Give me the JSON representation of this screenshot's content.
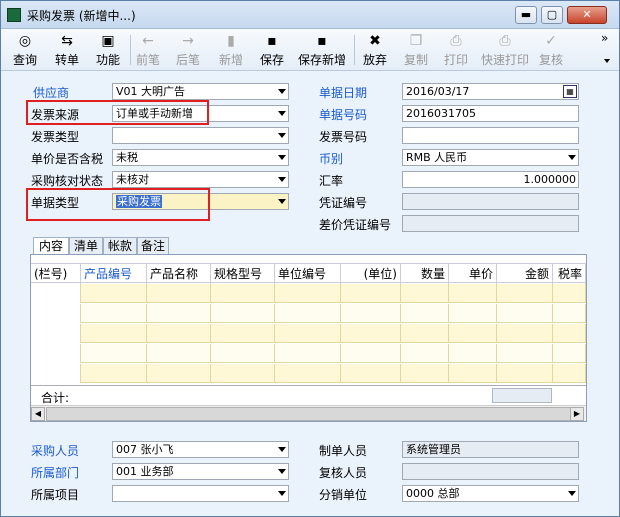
{
  "window": {
    "title": "采购发票 (新增中...)",
    "min_glyph": "▬",
    "max_glyph": "▢",
    "close_glyph": "✕"
  },
  "toolbar": {
    "buttons": [
      {
        "label": "查询",
        "icon": "query-icon",
        "glyph": "◎",
        "enabled": true
      },
      {
        "label": "转单",
        "icon": "convert-icon",
        "glyph": "⇆",
        "enabled": true
      },
      {
        "label": "功能",
        "icon": "function-icon",
        "glyph": "▣",
        "enabled": true
      },
      {
        "label": "前笔",
        "icon": "prev-icon",
        "glyph": "←",
        "enabled": false
      },
      {
        "label": "后笔",
        "icon": "next-icon",
        "glyph": "→",
        "enabled": false
      },
      {
        "label": "新增",
        "icon": "new-icon",
        "glyph": "▮",
        "enabled": false
      },
      {
        "label": "保存",
        "icon": "save-icon",
        "glyph": "▪",
        "enabled": true
      },
      {
        "label": "保存新增",
        "icon": "save-new-icon",
        "glyph": "▪",
        "enabled": true
      },
      {
        "label": "放弃",
        "icon": "abandon-icon",
        "glyph": "✖",
        "enabled": true
      },
      {
        "label": "复制",
        "icon": "copy-icon",
        "glyph": "❐",
        "enabled": false
      },
      {
        "label": "打印",
        "icon": "print-icon",
        "glyph": "⎙",
        "enabled": false
      },
      {
        "label": "快速打印",
        "icon": "quick-print-icon",
        "glyph": "⎙",
        "enabled": false
      },
      {
        "label": "复核",
        "icon": "review-icon",
        "glyph": "✓",
        "enabled": false
      }
    ],
    "overflow_glyph": "»"
  },
  "form": {
    "supplier": {
      "label": "供应商",
      "value": "V01 大明广告"
    },
    "invoice_source": {
      "label": "发票来源",
      "value": "订单或手动新增"
    },
    "invoice_type": {
      "label": "发票类型",
      "value": ""
    },
    "tax_included": {
      "label": "单价是否含税",
      "value": "未税"
    },
    "verify_status": {
      "label": "采购核对状态",
      "value": "未核对"
    },
    "doc_type": {
      "label": "单据类型",
      "value": "采购发票"
    },
    "doc_date": {
      "label": "单据日期",
      "value": "2016/03/17"
    },
    "doc_no": {
      "label": "单据号码",
      "value": "2016031705"
    },
    "invoice_no": {
      "label": "发票号码",
      "value": ""
    },
    "currency": {
      "label": "币别",
      "value": "RMB 人民币"
    },
    "rate": {
      "label": "汇率",
      "value": "1.000000"
    },
    "voucher_no": {
      "label": "凭证编号",
      "value": ""
    },
    "diff_voucher_no": {
      "label": "差价凭证编号",
      "value": ""
    }
  },
  "tabs": [
    "内容",
    "清单",
    "帐款",
    "备注"
  ],
  "grid": {
    "columns": [
      "(栏号)",
      "产品编号",
      "产品名称",
      "规格型号",
      "单位编号",
      "(单位)",
      "数量",
      "单价",
      "金额",
      "税率"
    ],
    "total_label": "合计:"
  },
  "bottom": {
    "buyer": {
      "label": "采购人员",
      "value": "007 张小飞"
    },
    "dept": {
      "label": "所属部门",
      "value": "001 业务部"
    },
    "project": {
      "label": "所属项目",
      "value": ""
    },
    "maker": {
      "label": "制单人员",
      "value": "系统管理员"
    },
    "reviewer": {
      "label": "复核人员",
      "value": ""
    },
    "branch": {
      "label": "分销单位",
      "value": "0000 总部"
    }
  },
  "colors": {
    "link_blue": "#1a5bd0",
    "highlight": "#e02020",
    "row_yellow": "#fff8d6"
  }
}
